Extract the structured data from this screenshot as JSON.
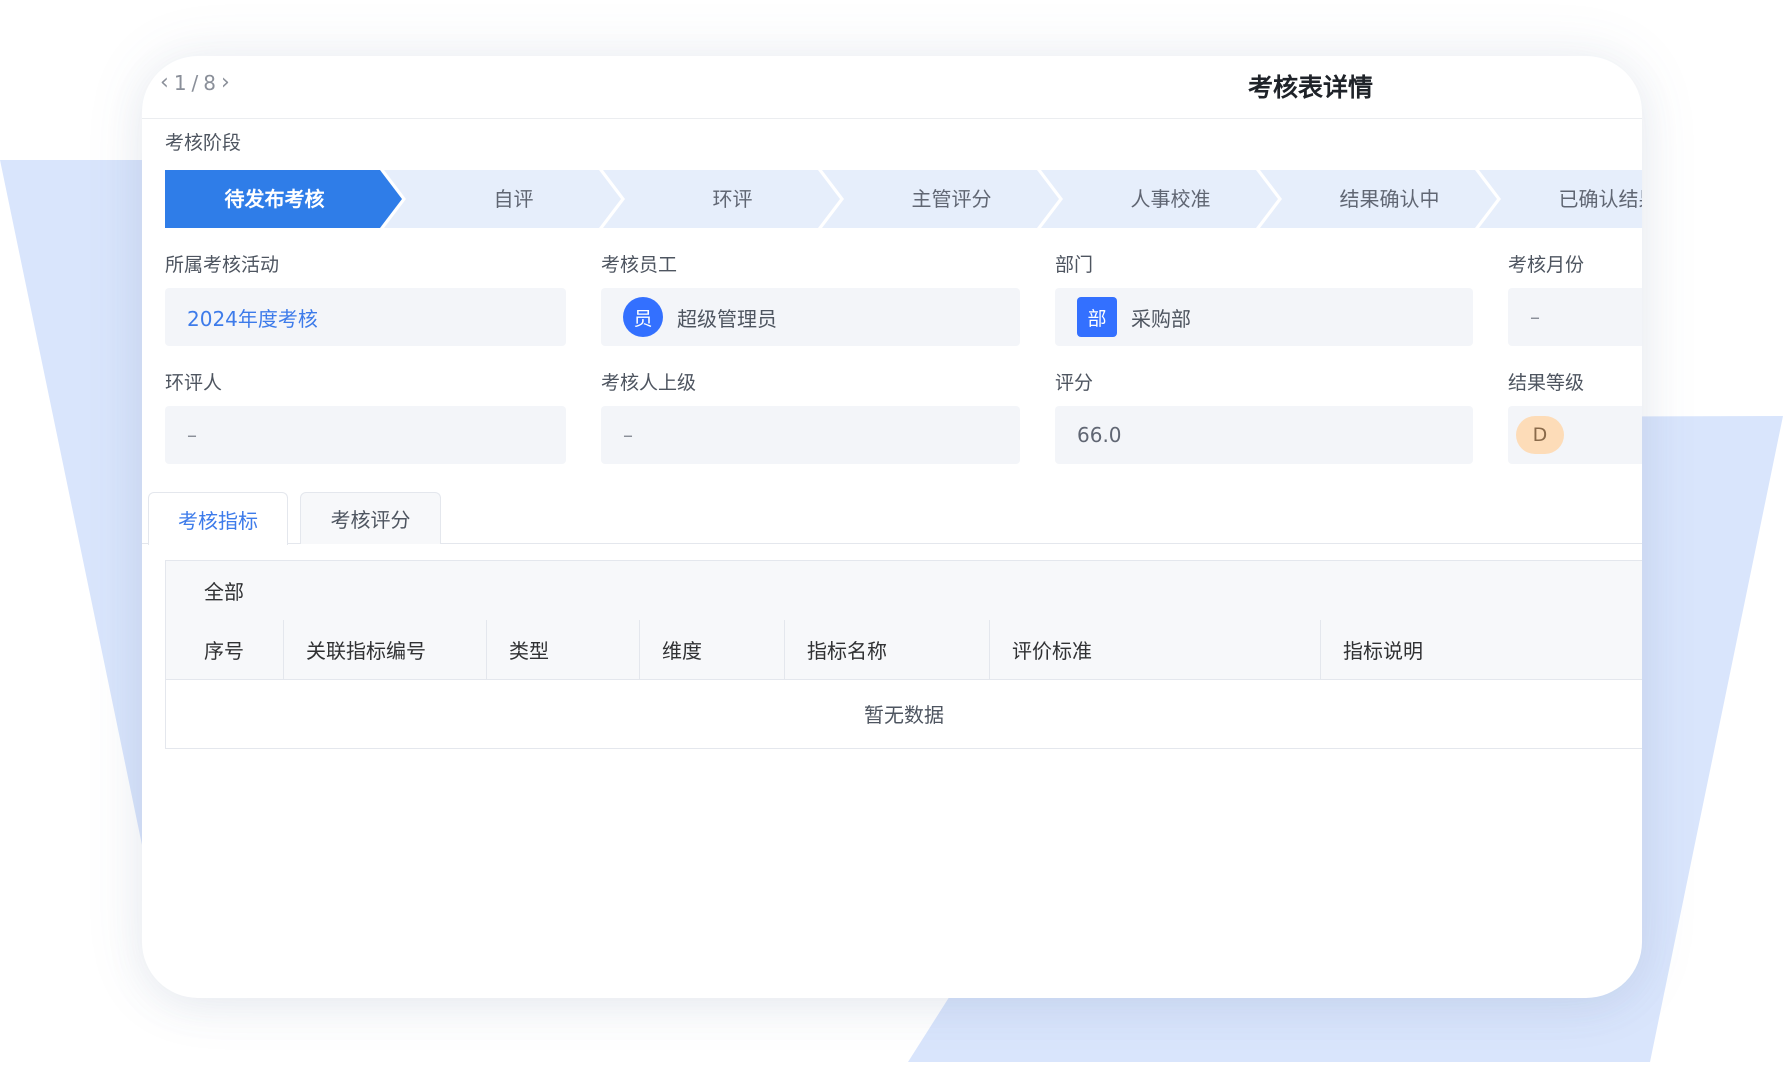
{
  "pager": {
    "current": "1",
    "separator": "/",
    "total": "8"
  },
  "title": "考核表详情",
  "stage": {
    "label": "考核阶段",
    "steps": [
      "待发布考核",
      "自评",
      "环评",
      "主管评分",
      "人事校准",
      "结果确认中",
      "已确认结果"
    ],
    "active_index": 0
  },
  "fields": {
    "activity": {
      "label": "所属考核活动",
      "value": "2024年度考核"
    },
    "employee": {
      "label": "考核员工",
      "avatar": "员",
      "value": "超级管理员"
    },
    "department": {
      "label": "部门",
      "avatar": "部",
      "value": "采购部"
    },
    "month": {
      "label": "考核月份",
      "value": "–"
    },
    "reviewer": {
      "label": "环评人",
      "value": "–"
    },
    "superior": {
      "label": "考核人上级",
      "value": "–"
    },
    "score": {
      "label": "评分",
      "value": "66.0"
    },
    "grade": {
      "label": "结果等级",
      "value": "D"
    }
  },
  "tabs": [
    {
      "label": "考核指标",
      "active": true
    },
    {
      "label": "考核评分",
      "active": false
    }
  ],
  "table": {
    "filter": "全部",
    "columns": [
      "序号",
      "关联指标编号",
      "类型",
      "维度",
      "指标名称",
      "评价标准",
      "指标说明"
    ],
    "empty_text": "暂无数据"
  },
  "colors": {
    "accent": "#3d7bea",
    "step_active": "#2f7de8",
    "step_inactive": "#e6eefb",
    "background_shape": "#d9e5fc",
    "grade_badge": "#fddcb8"
  }
}
